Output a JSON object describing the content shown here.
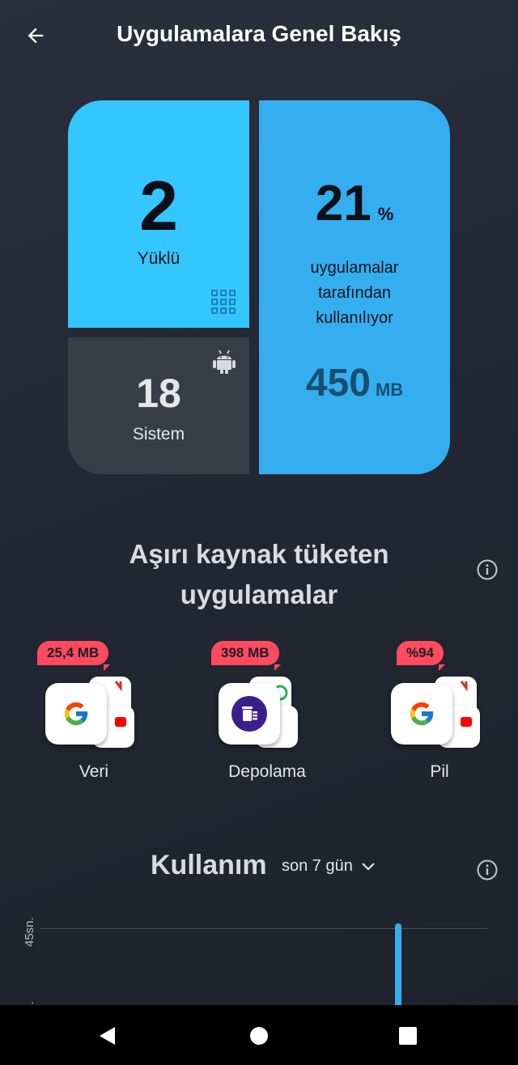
{
  "header": {
    "title": "Uygulamalara Genel Bakış",
    "back_icon": "arrow-left-icon"
  },
  "stats": {
    "installed": {
      "value": "2",
      "label": "Yüklü",
      "icon": "grid-icon"
    },
    "system": {
      "value": "18",
      "label": "Sistem",
      "icon": "android-icon"
    },
    "usage": {
      "percent": "21",
      "percent_symbol": "%",
      "lines": [
        "uygulamalar",
        "tarafından",
        "kullanılıyor"
      ],
      "size_value": "450",
      "size_unit": "MB"
    }
  },
  "resource_hogs": {
    "title_line1": "Aşırı kaynak tüketen",
    "title_line2": "uygulamalar",
    "info_icon": "info-icon",
    "items": [
      {
        "label": "Veri",
        "badge": "25,4 MB",
        "front_icon": "google-icon"
      },
      {
        "label": "Depolama",
        "badge": "398 MB",
        "front_icon": "cleaner-icon"
      },
      {
        "label": "Pil",
        "badge": "%94",
        "front_icon": "google-icon"
      }
    ]
  },
  "usage": {
    "title": "Kullanım",
    "range": "son 7 gün",
    "info_icon": "info-icon"
  },
  "chart_data": {
    "type": "bar",
    "ytick_labels": [
      "45sn.",
      "n."
    ],
    "visible_bar_fraction_of_top_tick": 1.0
  },
  "colors": {
    "accent_cyan": "#33c6ff",
    "accent_blue": "#35aef0",
    "badge_red": "#ff4a5f",
    "tile_dark": "#393d48"
  },
  "navbar": {
    "back_icon": "triangle-back-icon",
    "home_icon": "circle-home-icon",
    "recents_icon": "square-recents-icon"
  }
}
